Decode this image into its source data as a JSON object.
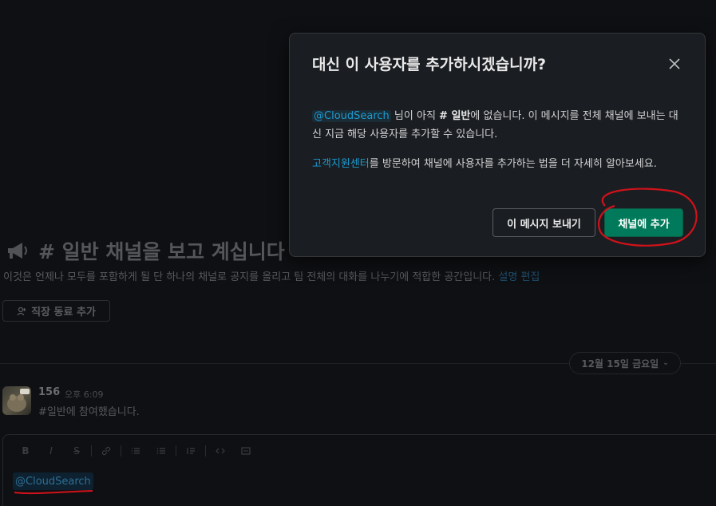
{
  "modal": {
    "title": "대신 이 사용자를 추가하시겠습니까?",
    "close_icon": "close-icon",
    "body1": {
      "mention": "@CloudSearch",
      "part_a": " 님이 아직 ",
      "channel": "# 일반",
      "part_b": "에 없습니다. 이 메시지를 전체 채널에 보내는 대신 지금 해당 사용자를 추가할 수 있습니다."
    },
    "body2": {
      "link": "고객지원센터",
      "rest": "를 방문하여 채널에 사용자를 추가하는 법을 더 자세히 알아보세요."
    },
    "secondary_button": "이 메시지 보내기",
    "primary_button": "채널에 추가"
  },
  "channel_intro": {
    "title": "# 일반 채널을 보고 계십니다",
    "description": "이것은 언제나 모두를 포함하게 될 단 하나의 채널로 공지를 올리고 팀 전체의 대화를 나누기에 적합한 공간입니다.",
    "edit_link": "설명 편집",
    "add_coworker_button": "직장 동료 추가"
  },
  "date_divider": "12월 15일 금요일",
  "message": {
    "author": "156",
    "time": "오후 6:09",
    "text": "#일반에 참여했습니다."
  },
  "composer": {
    "mention": "@CloudSearch",
    "toolbar": [
      "B",
      "I",
      "S"
    ]
  },
  "colors": {
    "primary": "#007a5a",
    "link": "#1d9bd1",
    "annotation": "#d0121b",
    "modal_bg": "#1a1d21"
  }
}
